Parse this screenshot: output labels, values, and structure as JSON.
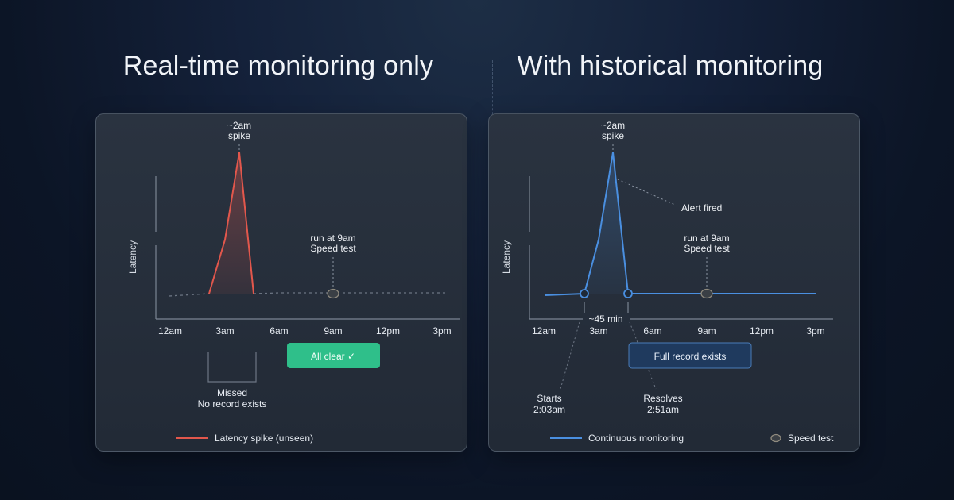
{
  "headings": {
    "left": "Real-time monitoring only",
    "right": "With historical monitoring"
  },
  "colors": {
    "spike": "#e2574c",
    "continuous": "#4a8fe0",
    "accent_green": "#2fbf8a",
    "full_record_bg": "#1f3a5e"
  },
  "left_panel": {
    "y_axis_label": "Latency",
    "x_ticks": [
      "12am",
      "3am",
      "6am",
      "9am",
      "12pm",
      "3pm"
    ],
    "spike_label_line1": "~2am",
    "spike_label_line2": "spike",
    "speed_test_line1": "run at 9am",
    "speed_test_line2": "Speed test",
    "status_button": "All clear ✓",
    "missed_line1": "Missed",
    "missed_line2": "No record exists",
    "legend_spike": "Latency spike (unseen)"
  },
  "right_panel": {
    "y_axis_label": "Latency",
    "x_ticks": [
      "12am",
      "3am",
      "6am",
      "9am",
      "12pm",
      "3pm"
    ],
    "spike_label_line1": "~2am",
    "spike_label_line2": "spike",
    "alert_label": "Alert fired",
    "speed_test_line1": "run at 9am",
    "speed_test_line2": "Speed test",
    "duration_label": "~45 min",
    "status_button": "Full record exists",
    "starts_line1": "Starts",
    "starts_line2": "2:03am",
    "resolves_line1": "Resolves",
    "resolves_line2": "2:51am",
    "legend_continuous": "Continuous monitoring",
    "legend_speed_test": "Speed test"
  }
}
